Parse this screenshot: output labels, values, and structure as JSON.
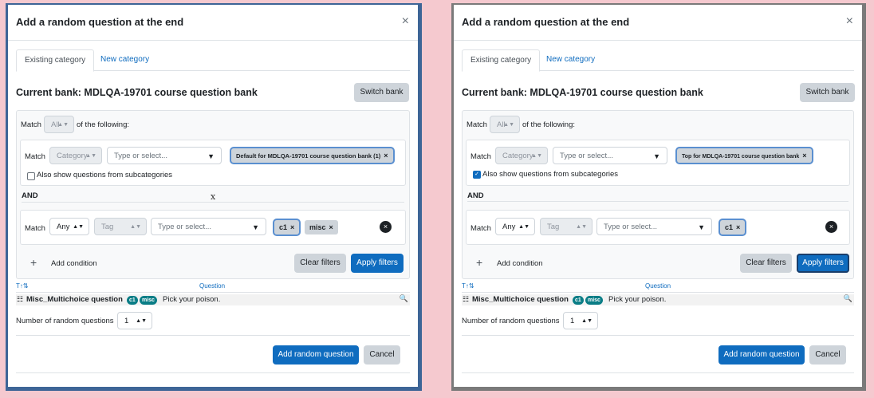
{
  "dialog": {
    "title": "Add a random question at the end",
    "close": "×",
    "tabs": {
      "existing": "Existing category",
      "new": "New category"
    },
    "bank_title": "Current bank: MDLQA-19701 course question bank",
    "switch_bank": "Switch bank",
    "match_label": "Match",
    "match_all": "All",
    "of_following": "of the following:",
    "category_label": "Category",
    "tag_label": "Tag",
    "any_label": "Any",
    "type_placeholder": "Type or select...",
    "subcategories_label": "Also show questions from subcategories",
    "and_label": "AND",
    "add_condition": "Add condition",
    "clear_filters": "Clear filters",
    "apply_filters": "Apply filters",
    "question_col": "Question",
    "sort_icon": "T↑⇅",
    "question_name": "Misc_Multichoice question",
    "question_text": "Pick your poison.",
    "tag_c1": "c1",
    "tag_misc": "misc",
    "num_random_label": "Number of random questions",
    "num_random_value": "1",
    "add_random": "Add random question",
    "cancel": "Cancel"
  },
  "left": {
    "category_chip": "Default for MDLQA-19701 course question bank (1)",
    "stray_text": "x"
  },
  "right": {
    "category_chip": "Top for MDLQA-19701 course question bank"
  },
  "colors": {
    "primary": "#0f6cbf",
    "badge": "#0a7d86",
    "background": "#f5c9cf"
  }
}
